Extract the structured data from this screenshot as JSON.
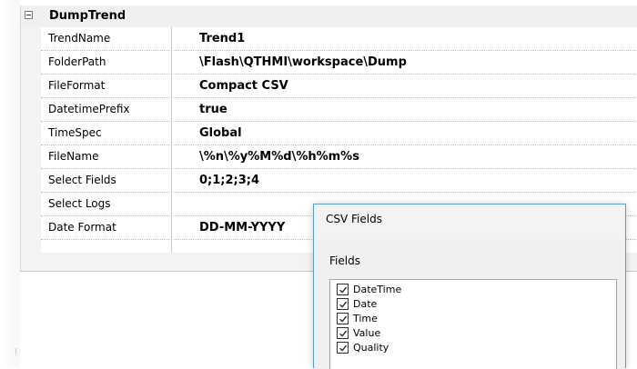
{
  "category": {
    "label": "DumpTrend",
    "expanded": true
  },
  "properties": [
    {
      "name": "TrendName",
      "value": "Trend1"
    },
    {
      "name": "FolderPath",
      "value": "\\Flash\\QTHMI\\workspace\\Dump"
    },
    {
      "name": "FileFormat",
      "value": "Compact CSV"
    },
    {
      "name": "DatetimePrefix",
      "value": "true"
    },
    {
      "name": "TimeSpec",
      "value": "Global"
    },
    {
      "name": "FileName",
      "value": "\\%n\\%y%M%d\\%h%m%s"
    },
    {
      "name": "Select Fields",
      "value": "0;1;2;3;4"
    },
    {
      "name": "Select Logs",
      "value": ""
    },
    {
      "name": "Date Format",
      "value": "DD-MM-YYYY"
    }
  ],
  "dialog": {
    "title": "CSV Fields",
    "fields_label": "Fields",
    "fields": [
      {
        "label": "DateTime",
        "checked": true
      },
      {
        "label": "Date",
        "checked": true
      },
      {
        "label": "Time",
        "checked": true
      },
      {
        "label": "Value",
        "checked": true
      },
      {
        "label": "Quality",
        "checked": true
      }
    ]
  },
  "colors": {
    "dialog_border": "#5b9bd5",
    "panel_bg": "#f3f3f3",
    "grid_bg": "#ffffff"
  }
}
